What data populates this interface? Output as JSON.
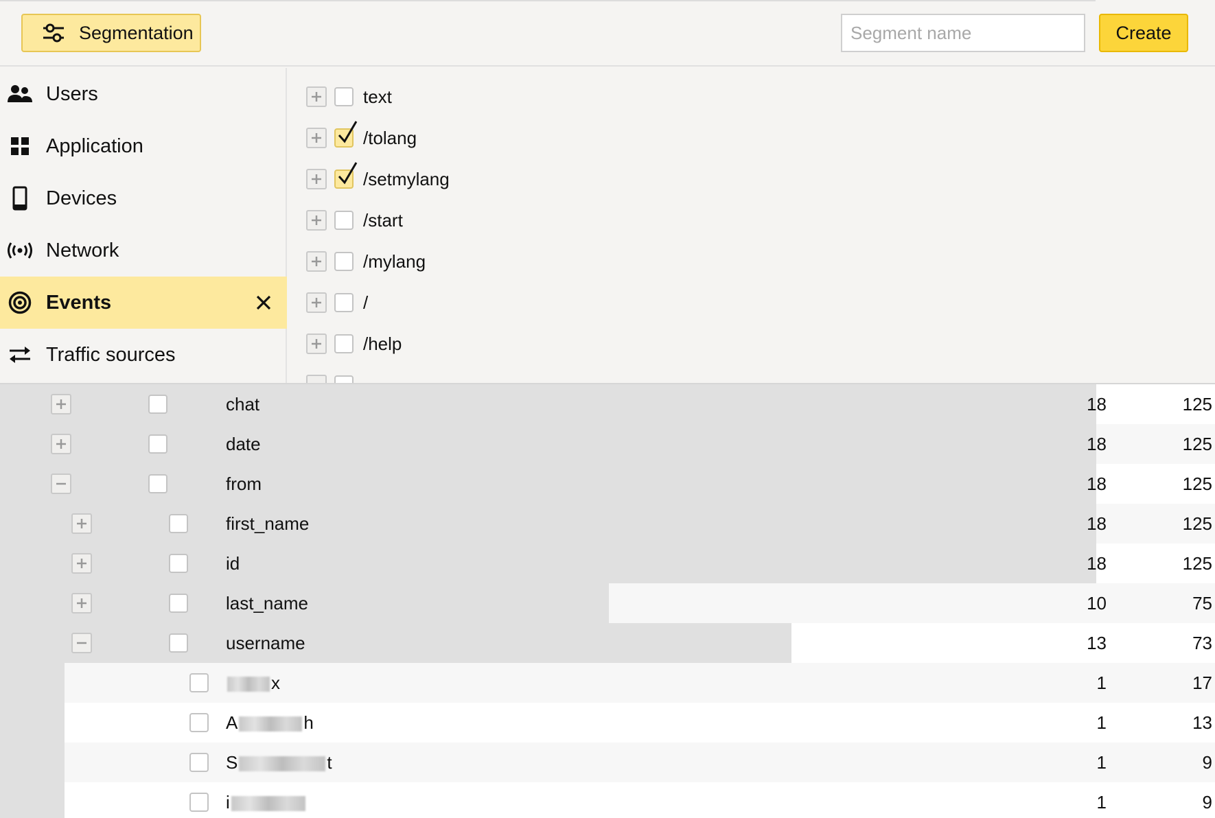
{
  "header": {
    "segmentation_label": "Segmentation",
    "segment_name_placeholder": "Segment name",
    "create_label": "Create"
  },
  "categories": [
    {
      "label": "Users",
      "icon": "users-icon"
    },
    {
      "label": "Application",
      "icon": "grid-icon"
    },
    {
      "label": "Devices",
      "icon": "phone-icon"
    },
    {
      "label": "Network",
      "icon": "signal-icon"
    },
    {
      "label": "Events",
      "icon": "target-icon",
      "active": true
    },
    {
      "label": "Traffic sources",
      "icon": "arrows-icon"
    }
  ],
  "events": [
    {
      "label": "text",
      "checked": false
    },
    {
      "label": "/tolang",
      "checked": true
    },
    {
      "label": "/setmylang",
      "checked": true
    },
    {
      "label": "/start",
      "checked": false
    },
    {
      "label": "/mylang",
      "checked": false
    },
    {
      "label": "/",
      "checked": false
    },
    {
      "label": "/help",
      "checked": false
    }
  ],
  "table": {
    "max_value": 18,
    "rows": [
      {
        "name": "chat",
        "v1": "18",
        "v2": "125",
        "bar": 18,
        "level": 0,
        "toggle": "plus"
      },
      {
        "name": "date",
        "v1": "18",
        "v2": "125",
        "bar": 18,
        "level": 0,
        "toggle": "plus"
      },
      {
        "name": "from",
        "v1": "18",
        "v2": "125",
        "bar": 18,
        "level": 0,
        "toggle": "minus"
      },
      {
        "name": "first_name",
        "v1": "18",
        "v2": "125",
        "bar": 18,
        "level": 1,
        "toggle": "plus"
      },
      {
        "name": "id",
        "v1": "18",
        "v2": "125",
        "bar": 18,
        "level": 1,
        "toggle": "plus"
      },
      {
        "name": "last_name",
        "v1": "10",
        "v2": "75",
        "bar": 10,
        "level": 1,
        "toggle": "plus"
      },
      {
        "name": "username",
        "v1": "13",
        "v2": "73",
        "bar": 13,
        "level": 1,
        "toggle": "minus"
      },
      {
        "name_prefix": "",
        "name_suffix": "x",
        "v1": "1",
        "v2": "17",
        "bar": 0,
        "level": 2,
        "toggle": "none"
      },
      {
        "name_prefix": "A",
        "name_suffix": "h",
        "v1": "1",
        "v2": "13",
        "bar": 0,
        "level": 2,
        "toggle": "none"
      },
      {
        "name_prefix": "S",
        "name_suffix": "t",
        "v1": "1",
        "v2": "9",
        "bar": 0,
        "level": 2,
        "toggle": "none"
      },
      {
        "name_prefix": "i",
        "name_suffix": "",
        "v1": "1",
        "v2": "9",
        "bar": 0,
        "level": 2,
        "toggle": "none"
      }
    ]
  },
  "colors": {
    "accent_light": "#fde99e",
    "accent": "#fcd53a",
    "bar": "#e0e0e0"
  }
}
